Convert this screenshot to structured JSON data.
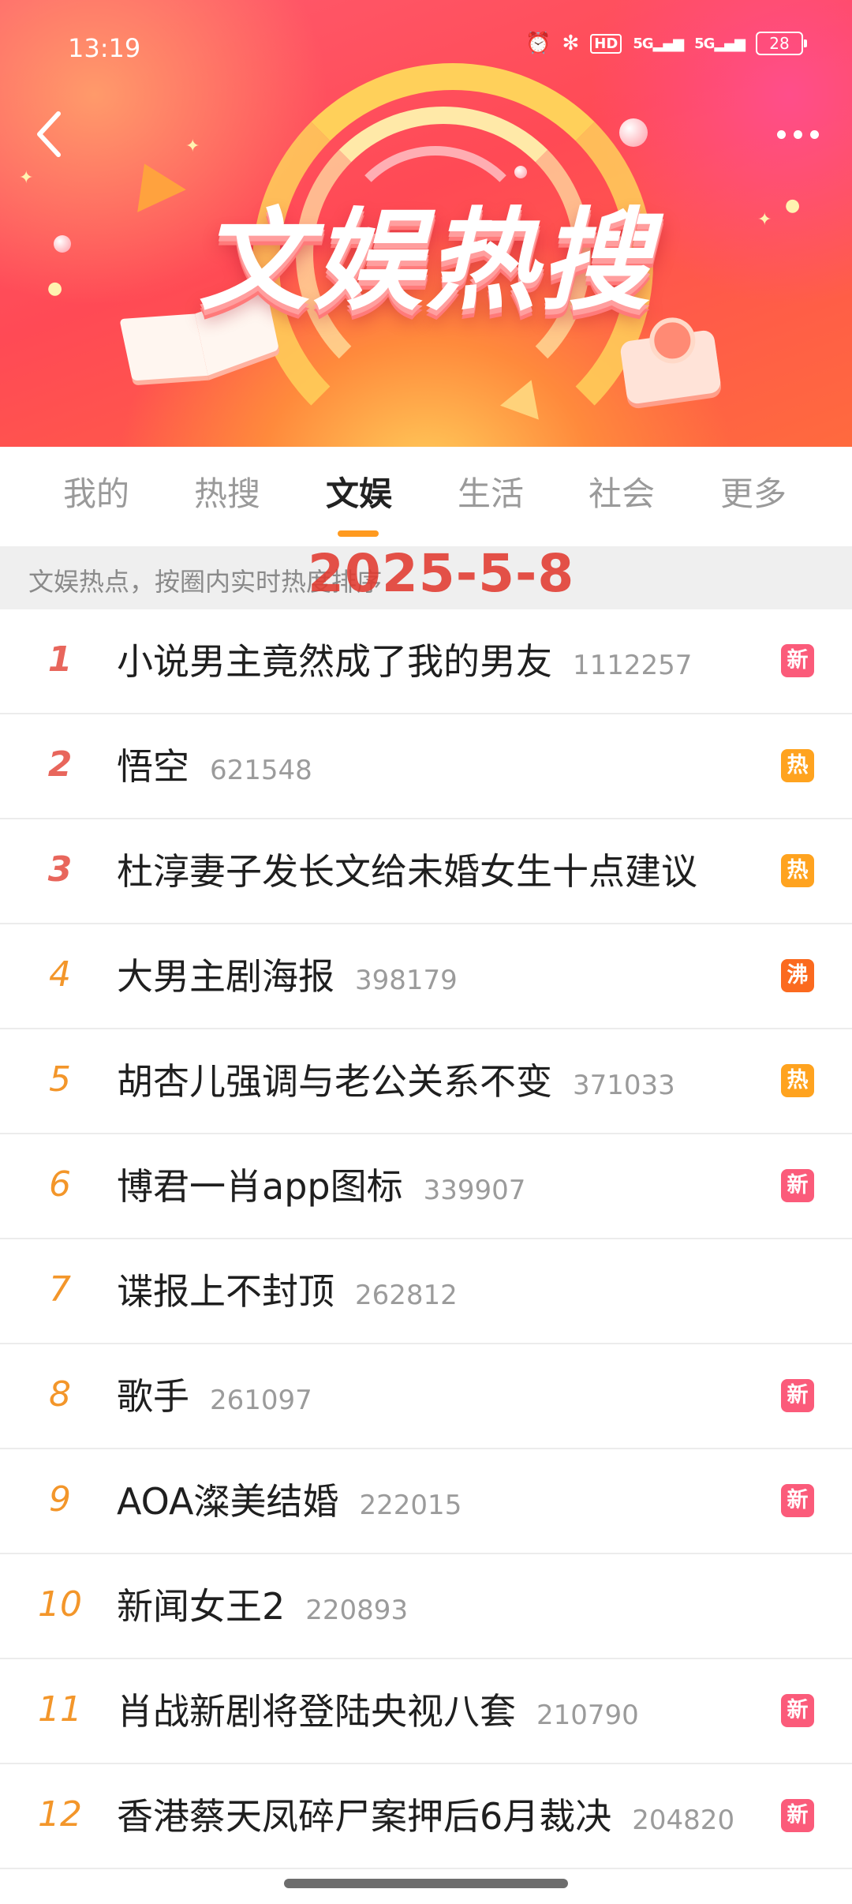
{
  "status_bar": {
    "time": "13:19",
    "icons": [
      "alarm-icon",
      "bluetooth-icon",
      "hd-icon",
      "signal-5g-icon",
      "signal-5g-icon",
      "battery-icon"
    ],
    "hd_label": "HD",
    "sig1_label": "5G",
    "sig2_label": "5G",
    "battery_level": "28"
  },
  "header": {
    "banner_title": "文娱热搜",
    "back_icon": "chevron-left-icon",
    "more_icon": "more-dots-icon"
  },
  "tabs": [
    {
      "label": "我的",
      "active": false
    },
    {
      "label": "热搜",
      "active": false
    },
    {
      "label": "文娱",
      "active": true
    },
    {
      "label": "生活",
      "active": false
    },
    {
      "label": "社会",
      "active": false
    },
    {
      "label": "更多",
      "active": false
    }
  ],
  "subtitle": {
    "text": "文娱热点，按圈内实时热度排序",
    "date_overlay": "2025-5-8"
  },
  "list": [
    {
      "rank": "1",
      "title": "小说男主竟然成了我的男友",
      "count": "1112257",
      "badge": "新"
    },
    {
      "rank": "2",
      "title": "悟空",
      "count": "621548",
      "badge": "热"
    },
    {
      "rank": "3",
      "title": "杜淳妻子发长文给未婚女生十点建议",
      "count": "",
      "badge": "热"
    },
    {
      "rank": "4",
      "title": "大男主剧海报",
      "count": "398179",
      "badge": "沸"
    },
    {
      "rank": "5",
      "title": "胡杏儿强调与老公关系不变",
      "count": "371033",
      "badge": "热"
    },
    {
      "rank": "6",
      "title": "博君一肖app图标",
      "count": "339907",
      "badge": "新"
    },
    {
      "rank": "7",
      "title": "谍报上不封顶",
      "count": "262812",
      "badge": ""
    },
    {
      "rank": "8",
      "title": "歌手",
      "count": "261097",
      "badge": "新"
    },
    {
      "rank": "9",
      "title": "AOA澯美结婚",
      "count": "222015",
      "badge": "新"
    },
    {
      "rank": "10",
      "title": "新闻女王2",
      "count": "220893",
      "badge": ""
    },
    {
      "rank": "11",
      "title": "肖战新剧将登陆央视八套",
      "count": "210790",
      "badge": "新"
    },
    {
      "rank": "12",
      "title": "香港蔡天凤碎尸案押后6月裁决",
      "count": "204820",
      "badge": "新"
    }
  ],
  "colors": {
    "badge_new": "#fb5b7a",
    "badge_hot": "#ffa31f",
    "badge_boil": "#fb6a1f",
    "rank_top": "#e8665c",
    "rank_normal": "#f3962a",
    "tab_underline": "#ff9a1f",
    "date_overlay": "#e23b30"
  }
}
